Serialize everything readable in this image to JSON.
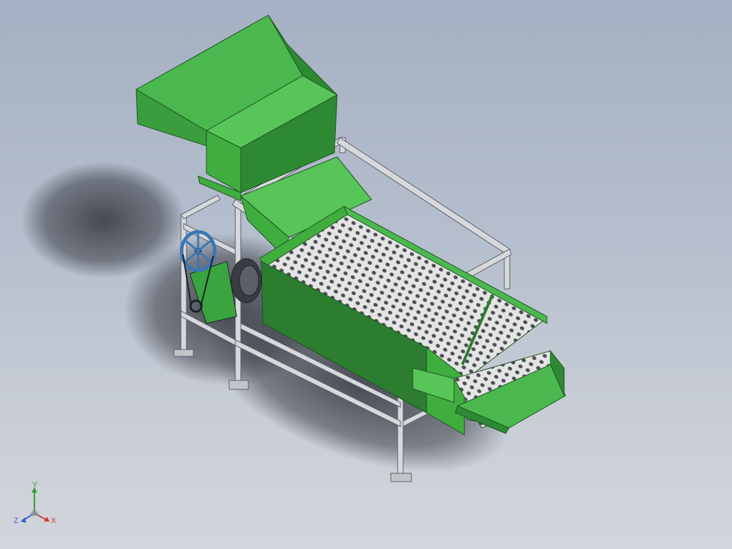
{
  "viewport": {
    "background_top": "#a4b0c3",
    "background_bottom": "#d2d5db"
  },
  "model": {
    "colors": {
      "green_light": "#58c558",
      "green_mid": "#3fae3f",
      "green_dark": "#2a7a2e",
      "frame": "#d6d8dc",
      "frame_edge": "#5a5e66",
      "mesh": "#e6e6e6",
      "motor": "#3a3c44",
      "pulley": "#3a78b4"
    }
  },
  "triad": {
    "y_label": "Y",
    "z_label": "Z",
    "x_label": "X",
    "y_color": "#2fa02f",
    "z_color": "#2f5fd0",
    "x_color": "#d03a2f"
  }
}
